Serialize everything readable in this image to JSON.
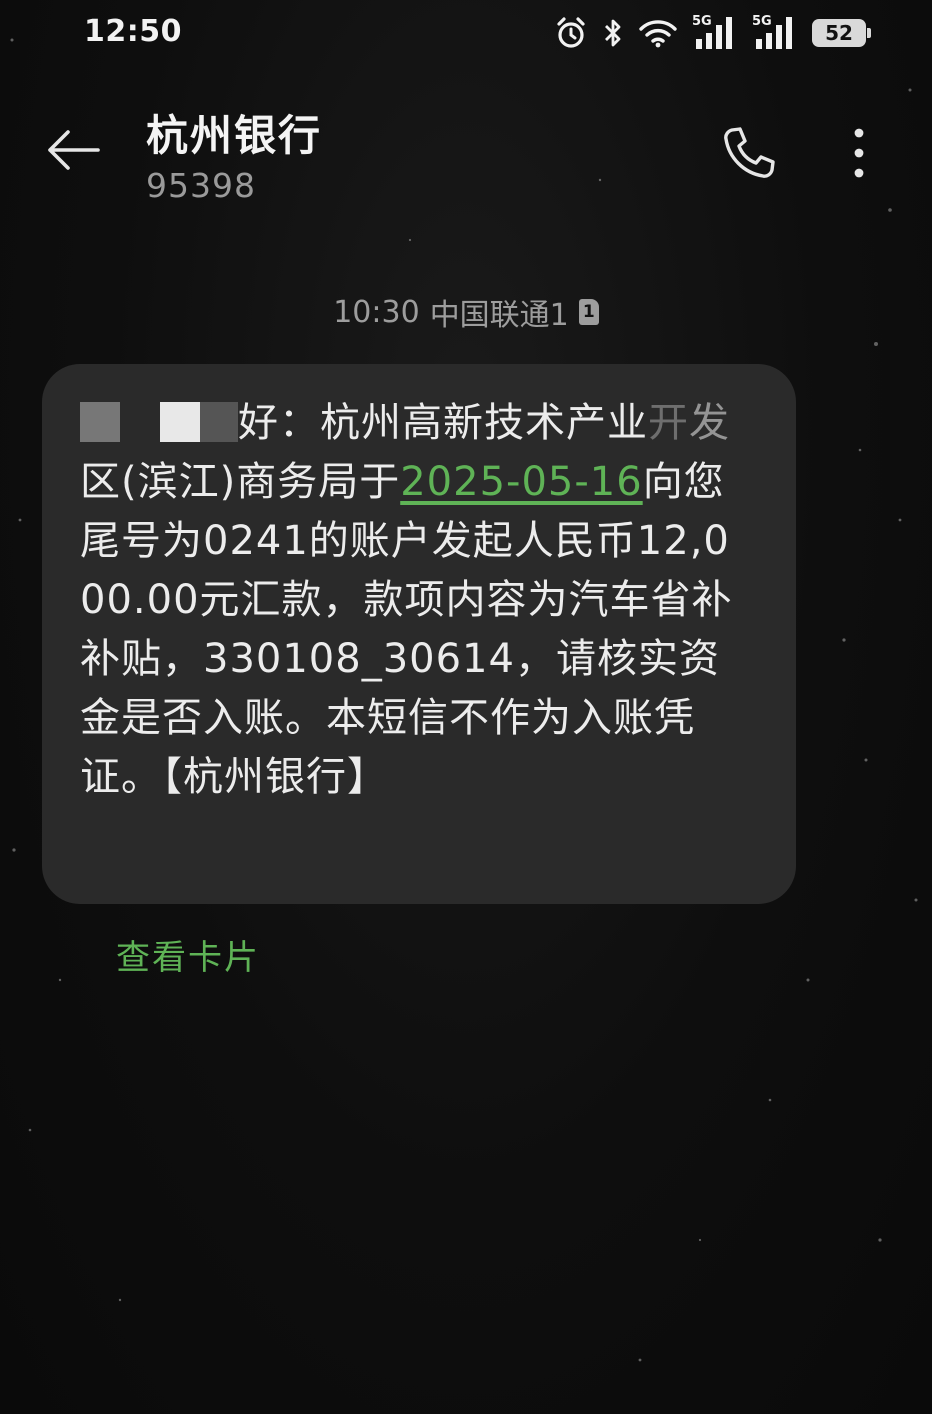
{
  "status_bar": {
    "time": "12:50",
    "icons": [
      "alarm-icon",
      "bluetooth-icon",
      "wifi-icon",
      "signal-5g-icon",
      "signal-5g-icon",
      "battery-icon"
    ],
    "network_tag_1": "5G",
    "network_tag_2": "5G",
    "battery_level": "52"
  },
  "header": {
    "contact_name": "杭州银行",
    "contact_number": "95398",
    "back_icon": "arrow-left-icon",
    "call_icon": "phone-icon",
    "more_icon": "more-vertical-icon"
  },
  "conversation": {
    "timestamp": "10:30",
    "carrier": "中国联通1",
    "sim_slot": "1"
  },
  "message": {
    "greeting_tail": "好：杭州高新技术产业",
    "org_tail": "区(滨江)商务局于",
    "org_masked_1": "开",
    "org_masked_2": "发",
    "date": "2025-05-16",
    "body": "向您尾号为0241的账户发起人民币12,000.00元汇款，款项内容为汽车省补补贴，330108_30614，请核实资金是否入账。本短信不作为入账凭证。【杭州银行】"
  },
  "card_link": {
    "label": "查看卡片"
  },
  "colors": {
    "background": "#0d0d0d",
    "bubble": "#2a2a2a",
    "accent_green": "#5fb356",
    "secondary_text": "#9d9d9d"
  }
}
